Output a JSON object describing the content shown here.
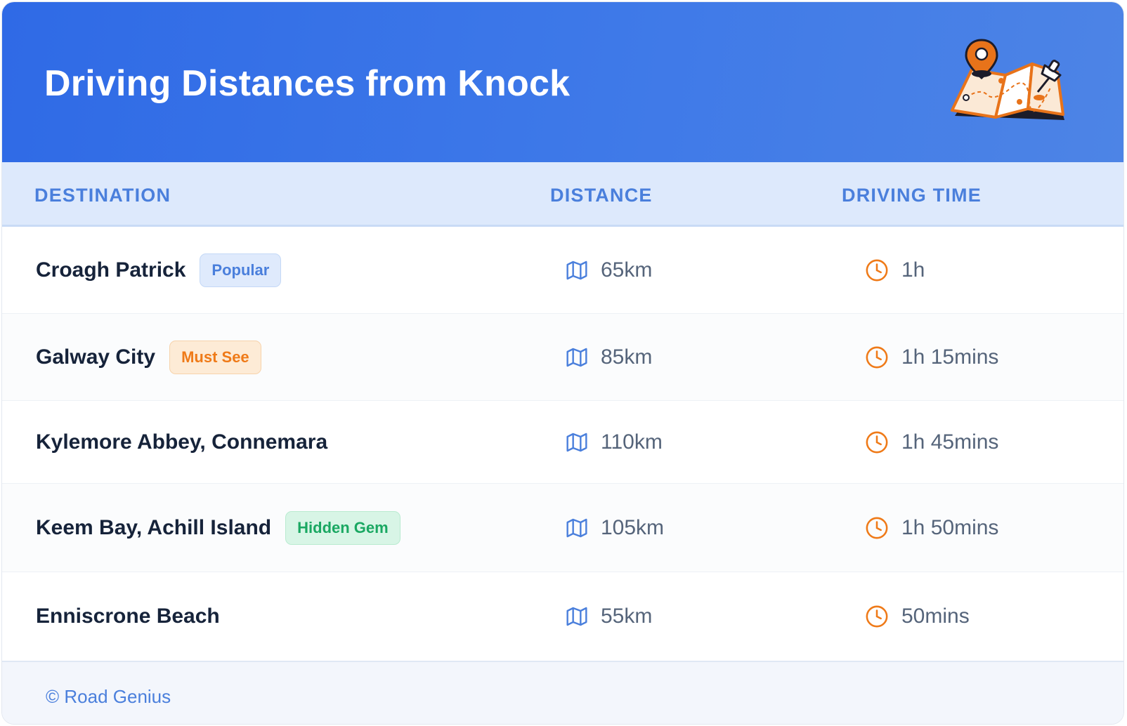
{
  "header": {
    "title": "Driving Distances from Knock"
  },
  "columns": {
    "destination": "DESTINATION",
    "distance": "DISTANCE",
    "driving_time": "DRIVING TIME"
  },
  "rows": [
    {
      "name": "Croagh Patrick",
      "badge": "Popular",
      "distance": "65km",
      "time": "1h"
    },
    {
      "name": "Galway City",
      "badge": "Must See",
      "distance": "85km",
      "time": "1h 15mins"
    },
    {
      "name": "Kylemore Abbey, Connemara",
      "badge": "",
      "distance": "110km",
      "time": "1h 45mins"
    },
    {
      "name": "Keem Bay, Achill Island",
      "badge": "Hidden Gem",
      "distance": "105km",
      "time": "1h 50mins"
    },
    {
      "name": "Enniscrone Beach",
      "badge": "",
      "distance": "55km",
      "time": "50mins"
    }
  ],
  "footer": {
    "brand": "© Road Genius"
  },
  "colors": {
    "header_blue": "#2f6ae6",
    "accent_blue": "#4a7fdc",
    "accent_orange": "#ef7a18",
    "accent_green": "#1aa862"
  },
  "icons": {
    "header": "folded-map-with-pins-icon",
    "distance": "map-icon",
    "time": "clock-icon"
  }
}
